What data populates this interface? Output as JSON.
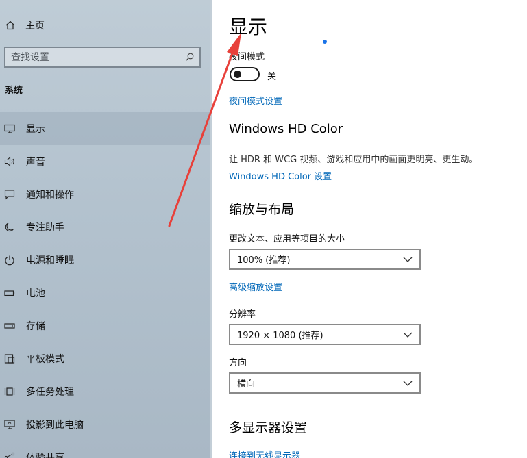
{
  "sidebar": {
    "home_label": "主页",
    "search_placeholder": "查找设置",
    "section_title": "系统",
    "items": [
      {
        "label": "显示",
        "icon": "monitor-icon",
        "selected": true
      },
      {
        "label": "声音",
        "icon": "speaker-icon",
        "selected": false
      },
      {
        "label": "通知和操作",
        "icon": "notification-icon",
        "selected": false
      },
      {
        "label": "专注助手",
        "icon": "moon-icon",
        "selected": false
      },
      {
        "label": "电源和睡眠",
        "icon": "power-icon",
        "selected": false
      },
      {
        "label": "电池",
        "icon": "battery-icon",
        "selected": false
      },
      {
        "label": "存储",
        "icon": "storage-icon",
        "selected": false
      },
      {
        "label": "平板模式",
        "icon": "tablet-icon",
        "selected": false
      },
      {
        "label": "多任务处理",
        "icon": "multitask-icon",
        "selected": false
      },
      {
        "label": "投影到此电脑",
        "icon": "project-icon",
        "selected": false
      },
      {
        "label": "体验共享",
        "icon": "share-icon",
        "selected": false
      }
    ]
  },
  "main": {
    "title": "显示",
    "night_light": {
      "label": "夜间模式",
      "state": "关",
      "settings_link": "夜间模式设置"
    },
    "hd_color": {
      "heading": "Windows HD Color",
      "description": "让 HDR 和 WCG 视频、游戏和应用中的画面更明亮、更生动。",
      "link": "Windows HD Color 设置"
    },
    "scale_layout": {
      "heading": "缩放与布局",
      "scale_label": "更改文本、应用等项目的大小",
      "scale_value": "100% (推荐)",
      "advanced_link": "高级缩放设置",
      "resolution_label": "分辨率",
      "resolution_value": "1920 × 1080 (推荐)",
      "orientation_label": "方向",
      "orientation_value": "横向"
    },
    "multi_display": {
      "heading": "多显示器设置",
      "wireless_link": "连接到无线显示器"
    }
  },
  "colors": {
    "accent": "#0067b8",
    "annotation_arrow": "#e8403a"
  }
}
